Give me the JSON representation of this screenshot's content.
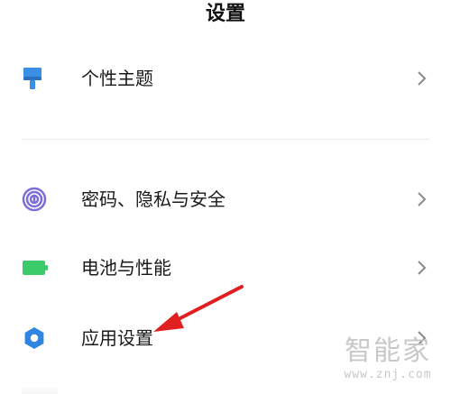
{
  "header": {
    "title": "设置"
  },
  "items": [
    {
      "label": "个性主题",
      "icon": "paint-brush-icon",
      "icon_color": "#3a8ee6"
    },
    {
      "label": "密码、隐私与安全",
      "icon": "fingerprint-icon",
      "icon_color": "#7b6fd8"
    },
    {
      "label": "电池与性能",
      "icon": "battery-icon",
      "icon_color": "#3ccb6a"
    },
    {
      "label": "应用设置",
      "icon": "gear-icon",
      "icon_color": "#2f86e0"
    }
  ],
  "annotation": {
    "arrow_color": "#e02020"
  },
  "watermark": {
    "text": "智能家",
    "url": "www.znj.com"
  }
}
